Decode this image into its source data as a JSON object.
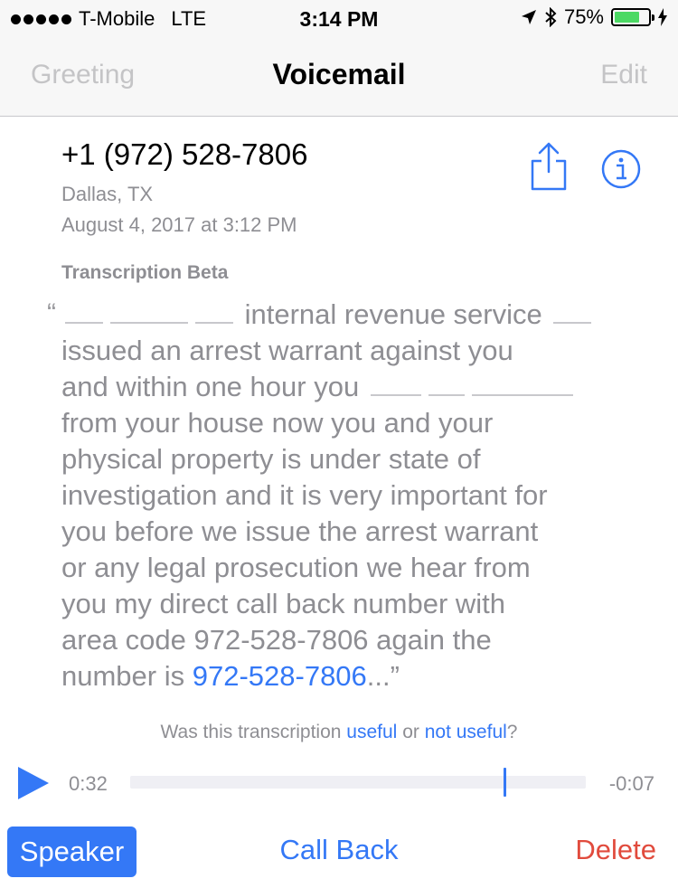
{
  "status_bar": {
    "carrier": "T-Mobile",
    "network": "LTE",
    "time": "3:14 PM",
    "battery": "75%",
    "battery_level": 0.75
  },
  "nav": {
    "left": "Greeting",
    "title": "Voicemail",
    "right": "Edit"
  },
  "voicemail": {
    "phone": "+1 (972) 528-7806",
    "location": "Dallas, TX",
    "date": "August 4, 2017 at 3:12 PM"
  },
  "transcription": {
    "label": "Transcription Beta",
    "quote_open": "“",
    "line1": "internal revenue service",
    "line2": "issued an arrest warrant against you",
    "line3": "and within one hour you",
    "line4": "from your house now you and your",
    "line5": "physical property is under state of",
    "line6": "investigation and it is very important for",
    "line7": "you before we issue the arrest warrant",
    "line8": "or any legal prosecution we hear from",
    "line9": "you my direct call back number with",
    "line10": "area code 972-528-7806 again the",
    "line11_prefix": "number is",
    "line11_link": "972-528-7806",
    "line11_suffix": "...”"
  },
  "feedback": {
    "prefix": "Was this transcription",
    "useful": "useful",
    "or": "or",
    "not_useful": "not useful",
    "suffix": "?"
  },
  "player": {
    "elapsed": "0:32",
    "remaining": "-0:07",
    "progress": 0.82
  },
  "actions": {
    "speaker": "Speaker",
    "call_back": "Call Back",
    "delete": "Delete"
  },
  "colors": {
    "accent": "#3478f6",
    "destructive": "#e14b3d",
    "muted": "#8e8e93"
  }
}
